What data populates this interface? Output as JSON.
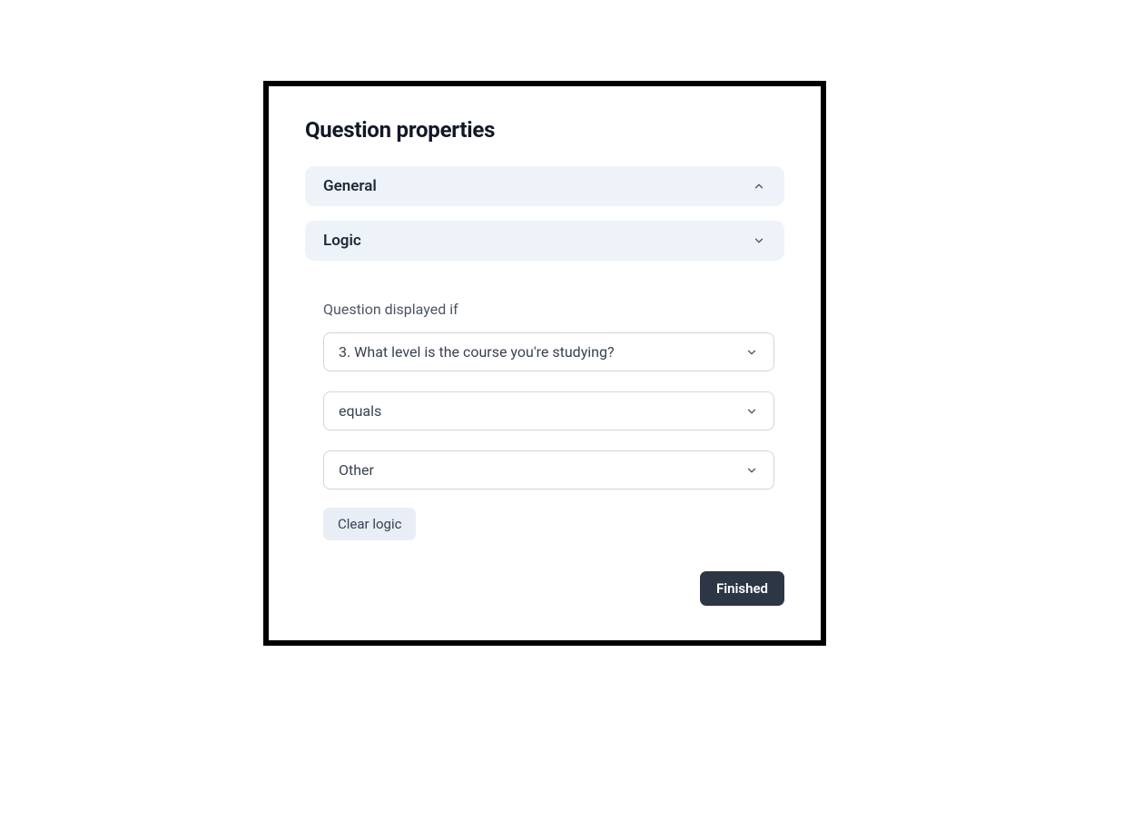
{
  "panel": {
    "title": "Question properties"
  },
  "accordion": {
    "general": {
      "label": "General"
    },
    "logic": {
      "label": "Logic"
    }
  },
  "logic": {
    "conditionLabel": "Question displayed if",
    "question": "3. What level is the course you're studying?",
    "operator": "equals",
    "value": "Other",
    "clearLabel": "Clear logic"
  },
  "footer": {
    "finishedLabel": "Finished"
  }
}
